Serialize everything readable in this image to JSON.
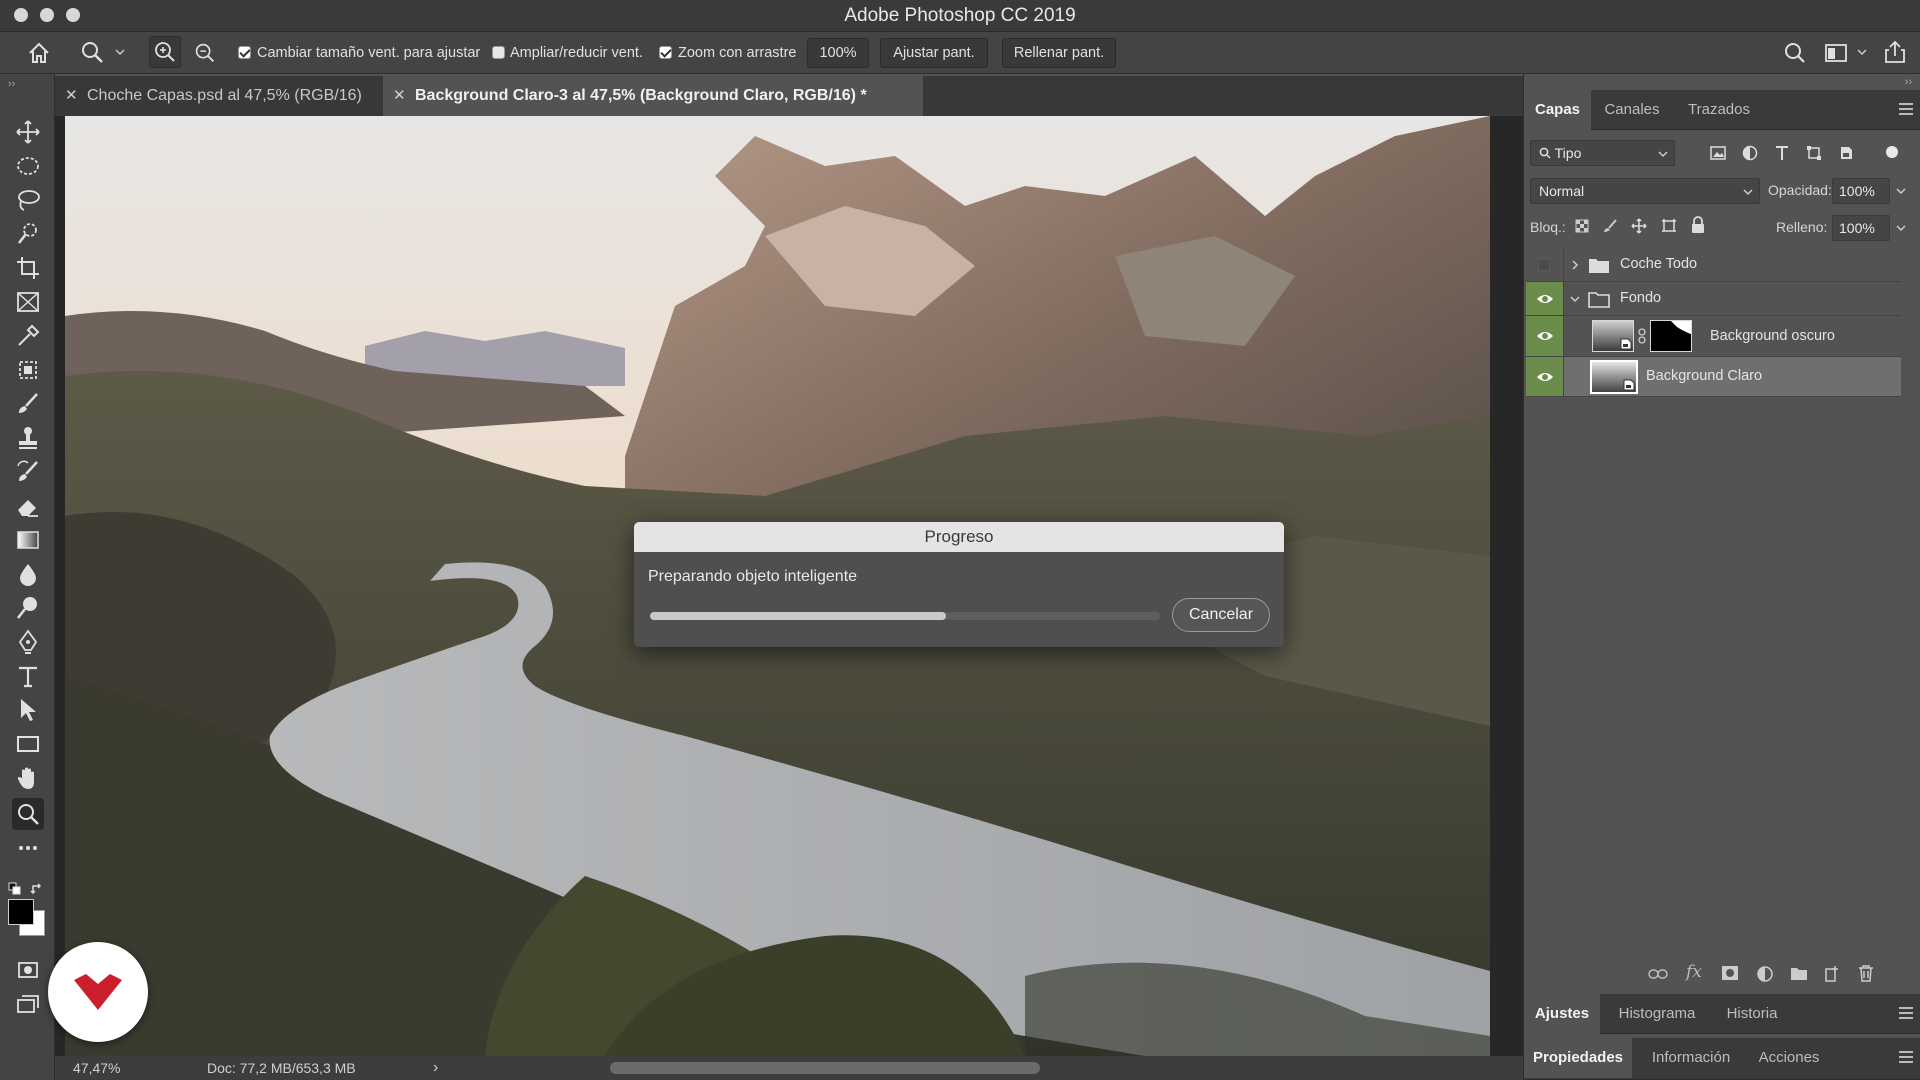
{
  "window": {
    "title": "Adobe Photoshop CC 2019"
  },
  "options_bar": {
    "resize_windows_label": "Cambiar tamaño vent. para ajustar",
    "resize_windows_checked": true,
    "zoom_all_label": "Ampliar/reducir vent.",
    "zoom_all_checked": false,
    "scrubby_label": "Zoom con arrastre",
    "scrubby_checked": true,
    "zoom_value": "100%",
    "fit_screen_label": "Ajustar pant.",
    "fill_screen_label": "Rellenar pant."
  },
  "document_tabs": [
    {
      "label": "Choche Capas.psd al 47,5% (RGB/16)",
      "active": false
    },
    {
      "label": "Background Claro-3 al 47,5% (Background Claro, RGB/16) *",
      "active": true
    }
  ],
  "status_bar": {
    "zoom": "47,47%",
    "doc_info": "Doc: 77,2 MB/653,3 MB",
    "arrow": "›"
  },
  "layers_panel": {
    "tabs": [
      "Capas",
      "Canales",
      "Trazados"
    ],
    "active_tab": "Capas",
    "filter_kind": "Tipo",
    "blend_mode": "Normal",
    "opacity_label": "Opacidad:",
    "opacity_value": "100%",
    "lock_label": "Bloq.:",
    "fill_label": "Relleno:",
    "fill_value": "100%",
    "layers": [
      {
        "name": "Coche Todo",
        "type": "group",
        "visible": false,
        "expanded": false
      },
      {
        "name": "Fondo",
        "type": "group",
        "visible": true,
        "expanded": true
      },
      {
        "name": "Background oscuro",
        "type": "smart-object-masked",
        "visible": true
      },
      {
        "name": "Background Claro",
        "type": "smart-object",
        "visible": true,
        "selected": true
      }
    ],
    "footer_fx": "fx"
  },
  "adjust_panel": {
    "tabs": [
      "Ajustes",
      "Histograma",
      "Historia"
    ],
    "active_tab": "Ajustes"
  },
  "props_panel": {
    "tabs": [
      "Propiedades",
      "Información",
      "Acciones"
    ],
    "active_tab": "Propiedades"
  },
  "progress_dialog": {
    "title": "Progreso",
    "message": "Preparando objeto inteligente",
    "progress_fraction": 0.58,
    "cancel_label": "Cancelar"
  },
  "colors": {
    "accent_visibility": "#6c8c4c",
    "brand_badge": "#cc1f2d"
  }
}
